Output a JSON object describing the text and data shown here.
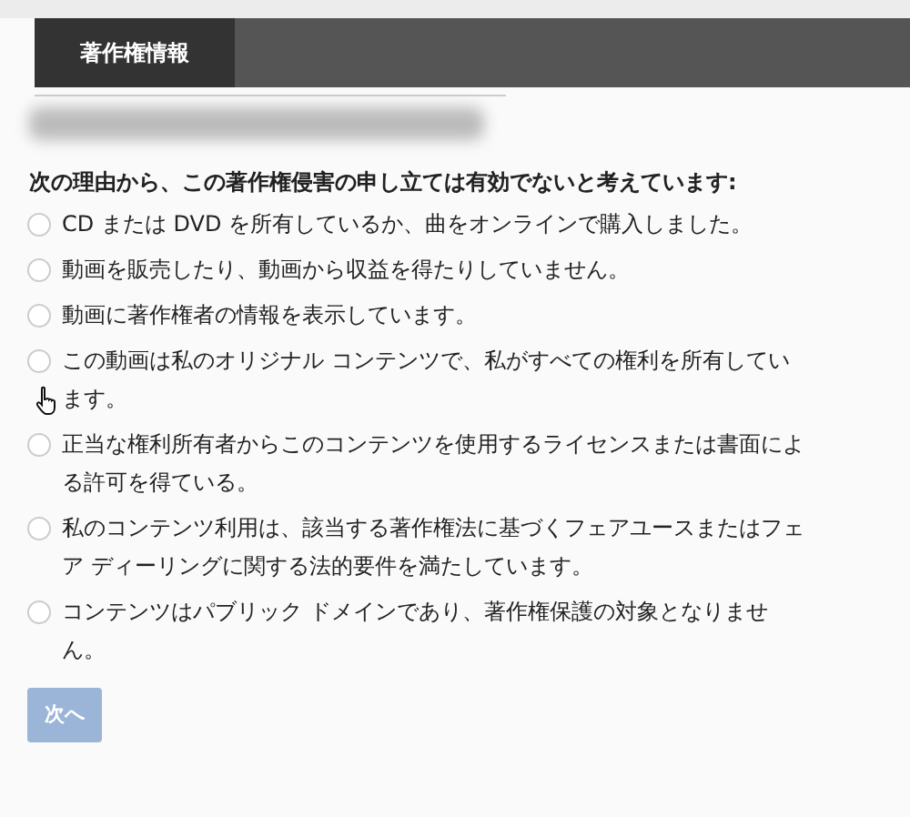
{
  "tabs": [
    {
      "label": "著作権情報",
      "selected": true
    }
  ],
  "prompt": "次の理由から、この著作権侵害の申し立ては有効でないと考えています:",
  "options": [
    {
      "label": "CD または DVD を所有しているか、曲をオンラインで購入しました。",
      "selected": false
    },
    {
      "label": "動画を販売したり、動画から収益を得たりしていません。",
      "selected": false
    },
    {
      "label": "動画に著作権者の情報を表示しています。",
      "selected": false
    },
    {
      "label": "この動画は私のオリジナル コンテンツで、私がすべての権利を所有しています。",
      "selected": false
    },
    {
      "label": "正当な権利所有者からこのコンテンツを使用するライセンスまたは書面による許可を得ている。",
      "selected": false
    },
    {
      "label": "私のコンテンツ利用は、該当する著作権法に基づくフェアユースまたはフェア ディーリングに関する法的要件を満たしています。",
      "selected": false
    },
    {
      "label": "コンテンツはパブリック ドメインであり、著作権保護の対象となりません。",
      "selected": false
    }
  ],
  "next_button": {
    "label": "次へ",
    "disabled": true
  }
}
